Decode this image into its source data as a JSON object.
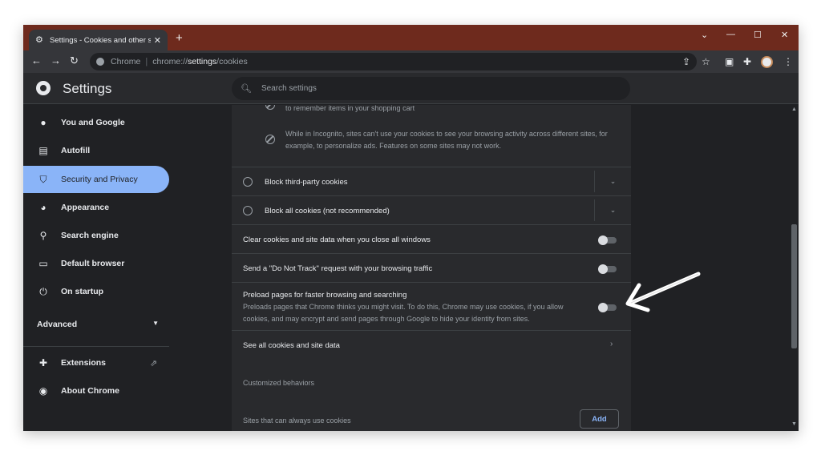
{
  "tab": {
    "title": "Settings - Cookies and other site",
    "close": "✕",
    "new_tab": "+"
  },
  "window_controls": {
    "dropdown": "⌄",
    "minimize": "—",
    "maximize": "☐",
    "close": "✕"
  },
  "toolbar": {
    "back": "←",
    "forward": "→",
    "reload": "↻",
    "site_label": "Chrome",
    "url_host": "chrome://",
    "url_path": "settings",
    "url_rest": "/cookies"
  },
  "header": {
    "title": "Settings",
    "search_placeholder": "Search settings"
  },
  "sidebar": {
    "items": [
      {
        "label": "You and Google",
        "icon": "person-icon"
      },
      {
        "label": "Autofill",
        "icon": "clipboard-icon"
      },
      {
        "label": "Security and Privacy",
        "icon": "shield-icon"
      },
      {
        "label": "Appearance",
        "icon": "palette-icon"
      },
      {
        "label": "Search engine",
        "icon": "search-icon"
      },
      {
        "label": "Default browser",
        "icon": "browser-icon"
      },
      {
        "label": "On startup",
        "icon": "power-icon"
      }
    ],
    "advanced": "Advanced",
    "extensions": "Extensions",
    "about": "About Chrome"
  },
  "main": {
    "cart_text": "to remember items in your shopping cart",
    "incognito_text": "While in Incognito, sites can't use your cookies to see your browsing activity across different sites, for example, to personalize ads. Features on some sites may not work.",
    "block_third_party": "Block third-party cookies",
    "block_all": "Block all cookies (not recommended)",
    "clear_on_exit": "Clear cookies and site data when you close all windows",
    "do_not_track": "Send a \"Do Not Track\" request with your browsing traffic",
    "preload_title": "Preload pages for faster browsing and searching",
    "preload_desc": "Preloads pages that Chrome thinks you might visit. To do this, Chrome may use cookies, if you allow cookies, and may encrypt and send pages through Google to hide your identity from sites.",
    "see_all": "See all cookies and site data",
    "customized": "Customized behaviors",
    "always_use": "Sites that can always use cookies",
    "add_label": "Add"
  },
  "colors": {
    "titlebar": "#6e2a1d",
    "accent": "#8ab4f8",
    "surface": "#292a2d",
    "background": "#202124"
  }
}
